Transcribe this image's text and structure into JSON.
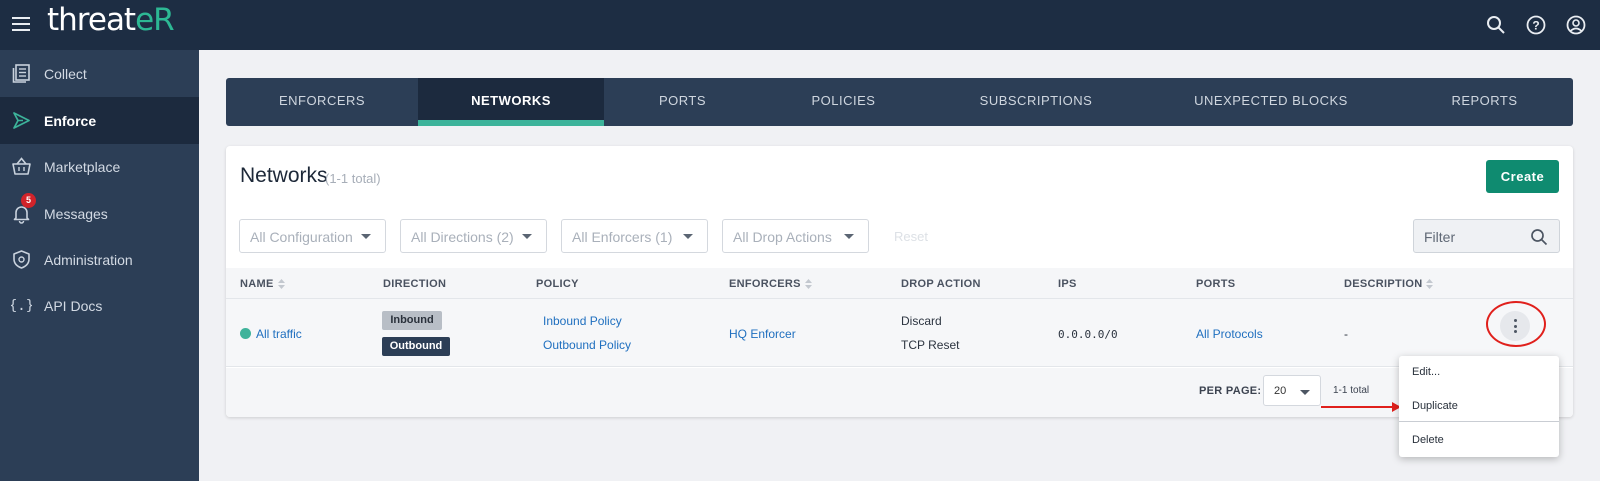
{
  "app": {
    "brand_left": "threat",
    "brand_right": "eR"
  },
  "sidebar": {
    "items": [
      {
        "label": "Collect",
        "icon": "collect-icon",
        "active": false
      },
      {
        "label": "Enforce",
        "icon": "enforce-icon",
        "active": true
      },
      {
        "label": "Marketplace",
        "icon": "basket-icon",
        "active": false
      },
      {
        "label": "Messages",
        "icon": "bell-icon",
        "active": false,
        "badge": "5"
      },
      {
        "label": "Administration",
        "icon": "shield-gear-icon",
        "active": false
      },
      {
        "label": "API Docs",
        "icon": "braces-icon",
        "active": false
      }
    ]
  },
  "tabs": [
    {
      "label": "ENFORCERS",
      "active": false
    },
    {
      "label": "NETWORKS",
      "active": true
    },
    {
      "label": "PORTS",
      "active": false
    },
    {
      "label": "POLICIES",
      "active": false
    },
    {
      "label": "SUBSCRIPTIONS",
      "active": false
    },
    {
      "label": "UNEXPECTED BLOCKS",
      "active": false
    },
    {
      "label": "REPORTS",
      "active": false
    }
  ],
  "page": {
    "title": "Networks",
    "count": "(1-1 total)",
    "create_label": "Create",
    "reset_label": "Reset",
    "filter_placeholder": "Filter"
  },
  "filters": [
    "All Configuration",
    "All Directions (2)",
    "All Enforcers (1)",
    "All Drop Actions"
  ],
  "table": {
    "headers": [
      "NAME",
      "DIRECTION",
      "POLICY",
      "ENFORCERS",
      "DROP ACTION",
      "IPS",
      "PORTS",
      "DESCRIPTION"
    ],
    "rows": [
      {
        "name": "All traffic",
        "directions": [
          "Inbound",
          "Outbound"
        ],
        "policies": [
          "Inbound Policy",
          "Outbound Policy"
        ],
        "enforcer": "HQ Enforcer",
        "drop_actions": [
          "Discard",
          "TCP Reset"
        ],
        "ips": "0.0.0.0/0",
        "ports": "All Protocols",
        "description": "-"
      }
    ]
  },
  "pagination": {
    "per_page_label": "PER PAGE:",
    "per_page_value": "20",
    "total": "1-1 total"
  },
  "context_menu": {
    "items": [
      "Edit...",
      "Duplicate",
      "Delete"
    ]
  },
  "colors": {
    "topbar": "#1d2d43",
    "sidebar": "#2c3e56",
    "accent": "#3cb39a",
    "create": "#0f8b70",
    "annotation": "#e0201c"
  }
}
